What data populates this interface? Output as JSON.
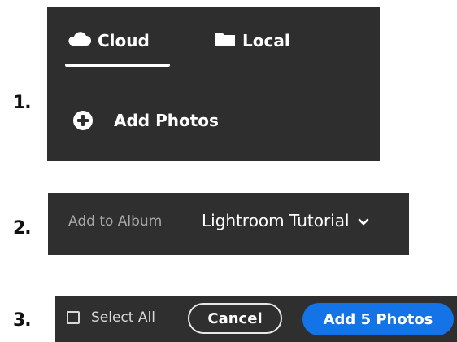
{
  "steps": [
    "1.",
    "2.",
    "3."
  ],
  "panel1": {
    "tabs": [
      {
        "label": "Cloud",
        "icon": "cloud-icon",
        "active": true
      },
      {
        "label": "Local",
        "icon": "folder-icon",
        "active": false
      }
    ],
    "add_photos_label": "Add Photos",
    "add_photos_icon": "plus-circle-icon"
  },
  "panel2": {
    "label": "Add to Album",
    "selected_album": "Lightroom Tutorial",
    "dropdown_icon": "chevron-down-icon"
  },
  "panel3": {
    "select_all_label": "Select All",
    "cancel_label": "Cancel",
    "add_label": "Add 5 Photos"
  },
  "colors": {
    "panel_bg": "#2f2f2f",
    "primary_button": "#1473e6",
    "muted_text": "#a8a8a8"
  }
}
